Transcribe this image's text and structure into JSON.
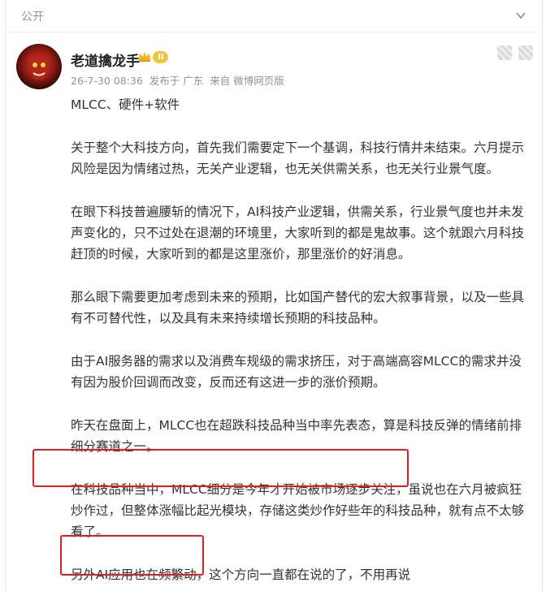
{
  "header": {
    "visibility": "公开"
  },
  "post": {
    "author": "老道擒龙手",
    "level_badge": "II",
    "meta": {
      "time": "26-7-30 08:36",
      "location": "发布于 广东",
      "source": "来自 微博网页版"
    },
    "paragraphs": [
      "MLCC、硬件+软件",
      "关于整个大科技方向，首先我们需要定下一个基调，科技行情并未结束。六月提示风险是因为情绪过热，无关产业逻辑，也无关供需关系，也无关行业景气度。",
      "在眼下科技普遍腰斩的情况下，AI科技产业逻辑，供需关系，行业景气度也并未发声变化的，只不过处在退潮的环境里，大家听到的都是鬼故事。这个就跟六月科技赶顶的时候，大家听到的都是这里涨价，那里涨价的好消息。",
      "那么眼下需要更加考虑到未来的预期，比如国产替代的宏大叙事背景，以及一些具有不可替代性，以及具有未来持续增长预期的科技品种。",
      "由于AI服务器的需求以及消费车规级的需求挤压，对于高端高容MLCC的需求并没有因为股价回调而改变，反而还有这进一步的涨价预期。",
      "昨天在盘面上，MLCC也在超跌科技品种当中率先表态，算是科技反弹的情绪前排细分赛道之一。",
      "在科技品种当中，MLCC细分是今年才开始被市场逐步关注，虽说也在六月被疯狂炒作过，但整体涨幅比起光模块，存储这类炒作好些年的科技品种，就有点不太够看了。",
      "另外AI应用也在频繁动，这个方向一直都在说的了，不用再说"
    ]
  },
  "colors": {
    "highlight_box": "#e02020",
    "meta_gray": "#939393",
    "badge_gold": "#f2c437"
  },
  "icons": [
    "chevron-down-icon",
    "crown-icon"
  ]
}
